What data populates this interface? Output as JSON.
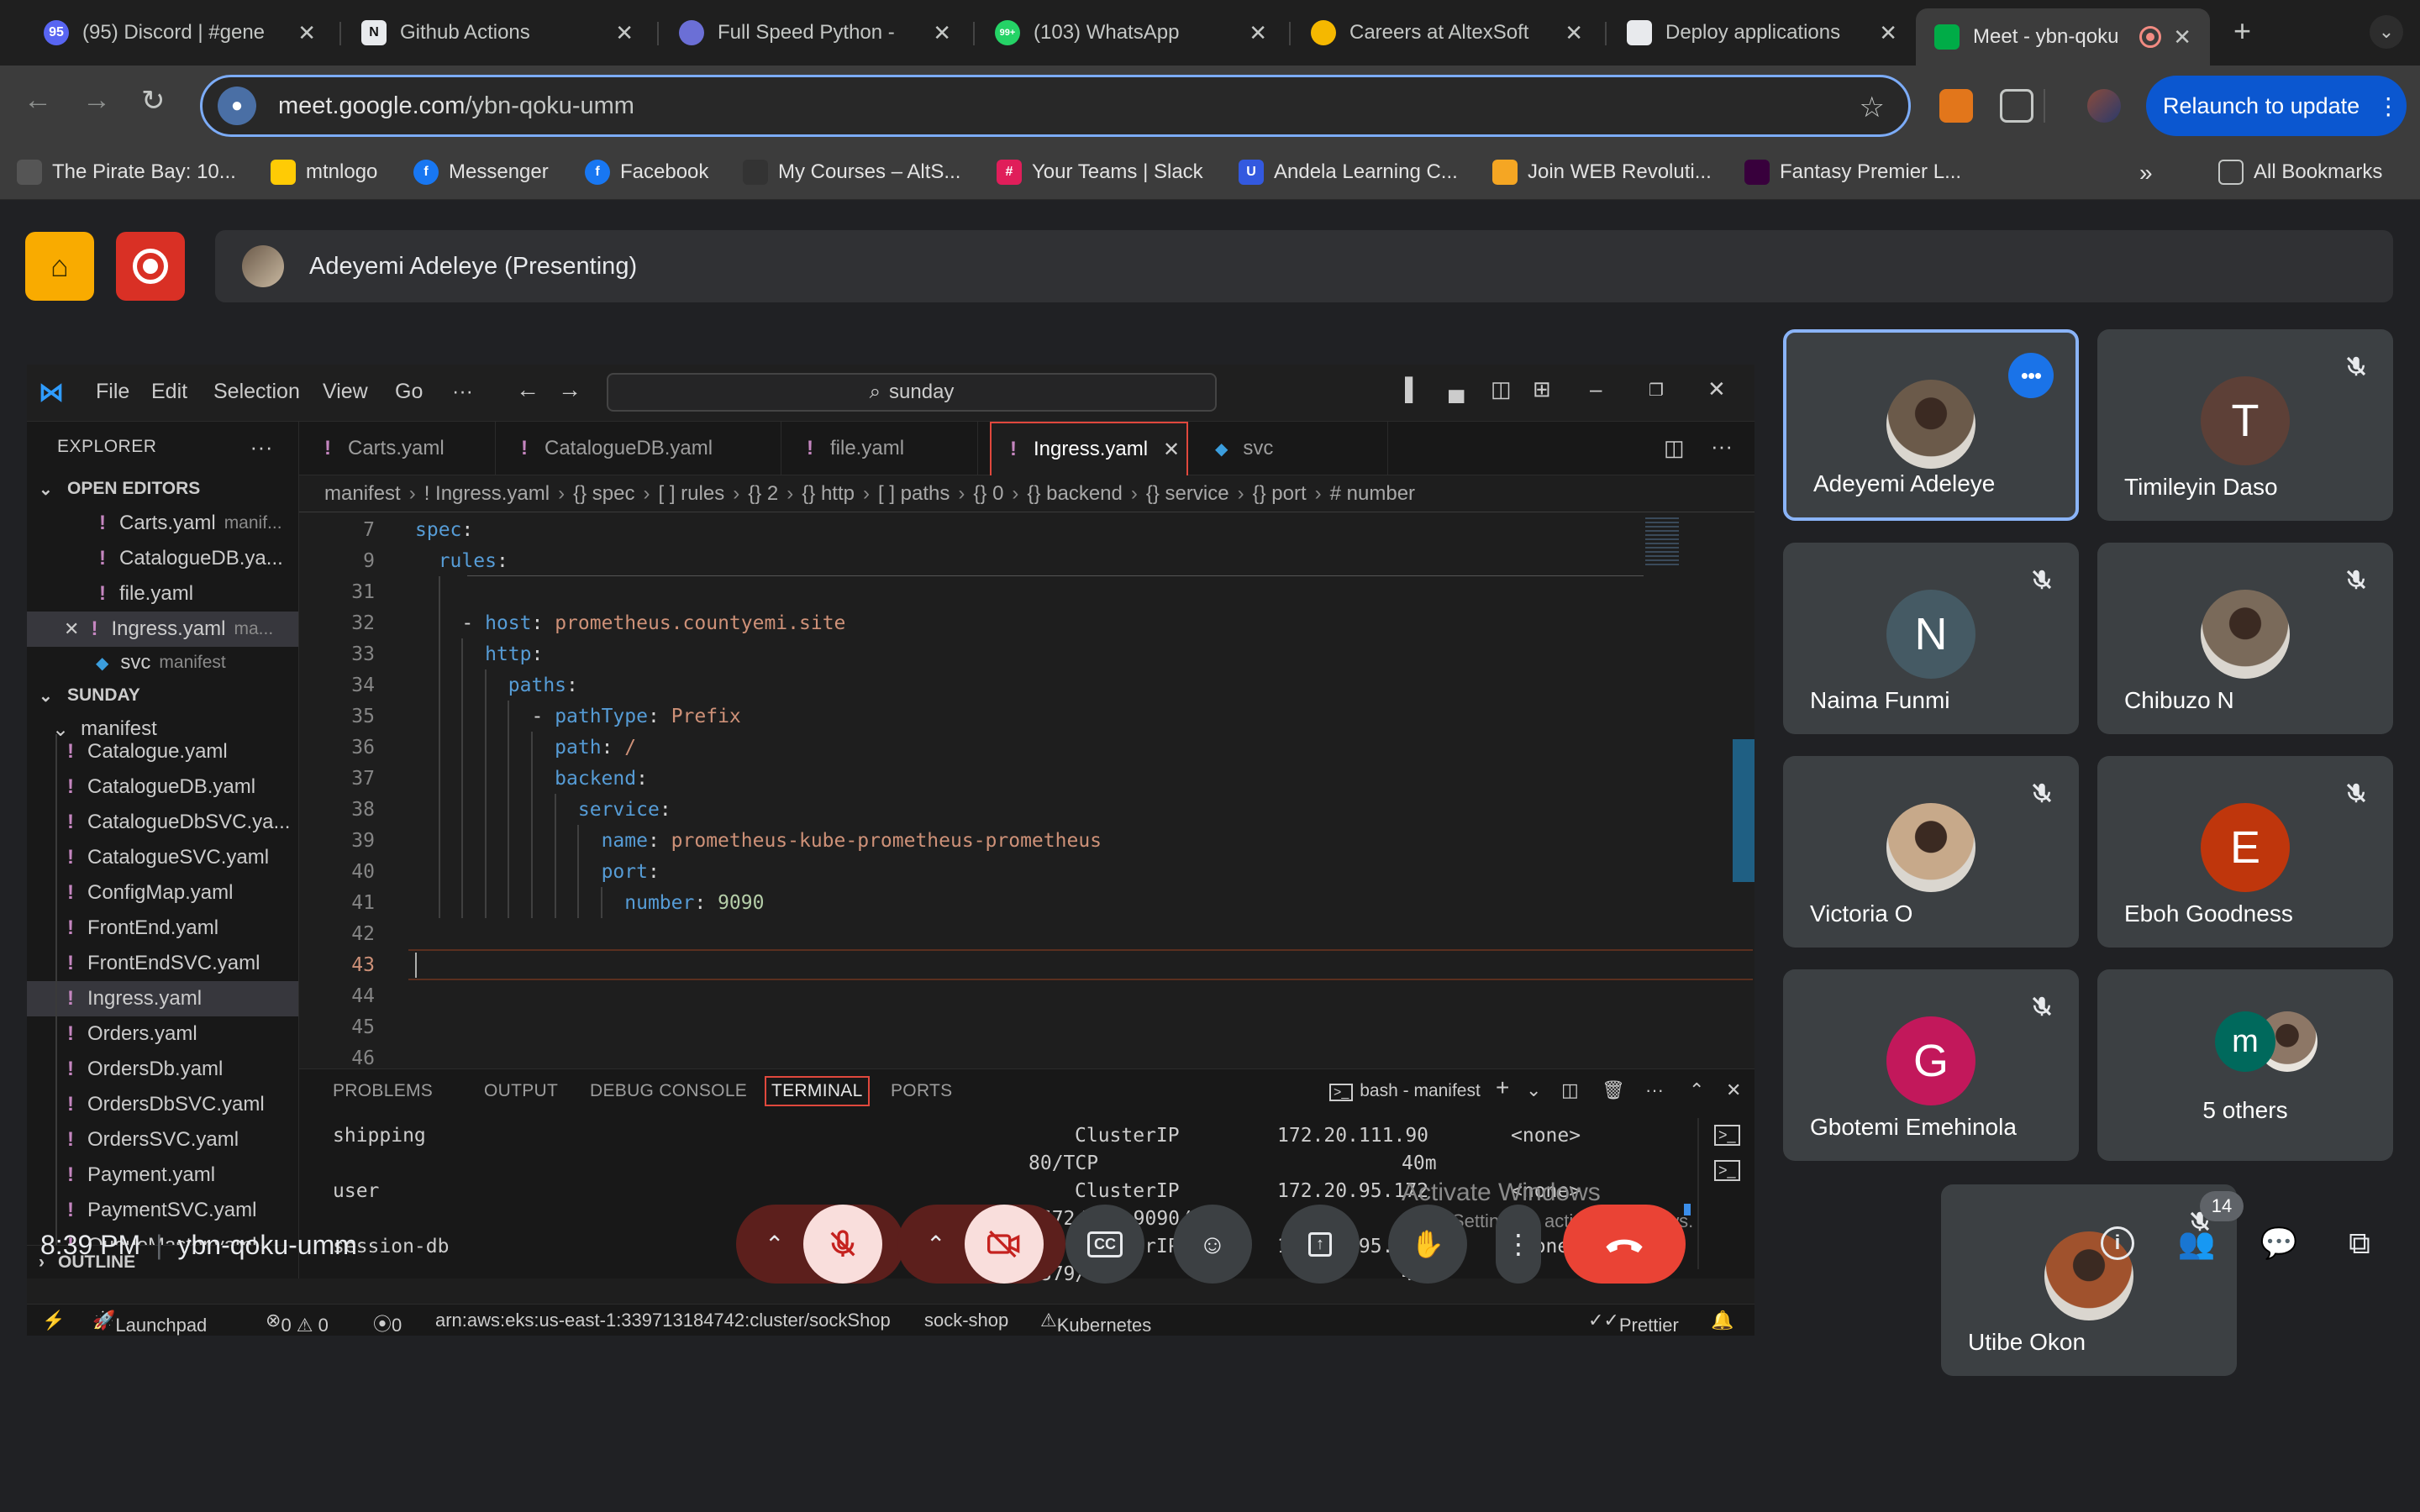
{
  "browser": {
    "tabs": [
      {
        "title": "(95) Discord | #gene",
        "color": "#5865f2",
        "badge": "95"
      },
      {
        "title": "Github Actions",
        "color": "#ffffff",
        "badge": "N"
      },
      {
        "title": "Full Speed Python -",
        "color": "#6b6fd6",
        "badge": ""
      },
      {
        "title": "(103) WhatsApp",
        "color": "#25d366",
        "badge": "99+"
      },
      {
        "title": "Careers at AltexSoft",
        "color": "#f5b800",
        "badge": ""
      },
      {
        "title": "Deploy applications",
        "color": "#e8eaed",
        "badge": ""
      },
      {
        "title": "Meet - ybn-qoku",
        "color": "#00ac47",
        "badge": ""
      }
    ],
    "url_host": "meet.google.com",
    "url_path": "/ybn-qoku-umm",
    "relaunch_label": "Relaunch to update",
    "bookmarks": [
      {
        "label": "The Pirate Bay: 10...",
        "color": "#555"
      },
      {
        "label": "mtnlogo",
        "color": "#ffcb05"
      },
      {
        "label": "Messenger",
        "color": "#1877f2"
      },
      {
        "label": "Facebook",
        "color": "#1877f2"
      },
      {
        "label": "My Courses – AltS...",
        "color": "#333"
      },
      {
        "label": "Your Teams | Slack",
        "color": "#e01e5a"
      },
      {
        "label": "Andela Learning C...",
        "color": "#3359df"
      },
      {
        "label": "Join WEB Revoluti...",
        "color": "#f5a623"
      },
      {
        "label": "Fantasy Premier L...",
        "color": "#38003c"
      }
    ],
    "all_bookmarks": "All Bookmarks"
  },
  "meet": {
    "presenting_label": "Adeyemi Adeleye (Presenting)",
    "time": "8:39 PM",
    "meeting_code": "ybn-qoku-umm",
    "participant_count": "14",
    "participants": [
      {
        "name": "Adeyemi Adeleye",
        "initial": "",
        "color": "#6b5a4a",
        "photo": true
      },
      {
        "name": "Timileyin Daso",
        "initial": "T",
        "color": "#5d4037",
        "photo": false
      },
      {
        "name": "Naima Funmi",
        "initial": "N",
        "color": "#455a64",
        "photo": false
      },
      {
        "name": "Chibuzo N",
        "initial": "",
        "color": "#7a6a5a",
        "photo": true
      },
      {
        "name": "Victoria O",
        "initial": "",
        "color": "#c7a98a",
        "photo": true
      },
      {
        "name": "Eboh Goodness",
        "initial": "E",
        "color": "#bf360c",
        "photo": false
      },
      {
        "name": "Gbotemi Emehinola",
        "initial": "G",
        "color": "#c2185b",
        "photo": false
      },
      {
        "name": "5 others",
        "initial": "m",
        "color": "#00695c",
        "photo": false
      },
      {
        "name": "Utibe Okon",
        "initial": "",
        "color": "#a0522d",
        "photo": true
      }
    ]
  },
  "vscode": {
    "menu": [
      "File",
      "Edit",
      "Selection",
      "View",
      "Go",
      "···"
    ],
    "search": "sunday",
    "explorer_title": "EXPLORER",
    "open_editors_title": "OPEN EDITORS",
    "open_editors": [
      {
        "name": "Carts.yaml",
        "hint": "manif...",
        "svc": false,
        "close": false
      },
      {
        "name": "CatalogueDB.ya...",
        "hint": "",
        "svc": false,
        "close": false
      },
      {
        "name": "file.yaml",
        "hint": "",
        "svc": false,
        "close": false
      },
      {
        "name": "Ingress.yaml",
        "hint": "ma...",
        "svc": false,
        "close": true
      },
      {
        "name": "svc",
        "hint": "manifest",
        "svc": true,
        "close": false
      }
    ],
    "workspace_title": "SUNDAY",
    "folder": "manifest",
    "files": [
      "Catalogue.yaml",
      "CatalogueDB.yaml",
      "CatalogueDbSVC.ya...",
      "CatalogueSVC.yaml",
      "ConfigMap.yaml",
      "FrontEnd.yaml",
      "FrontEndSVC.yaml",
      "Ingress.yaml",
      "Orders.yaml",
      "OrdersDb.yaml",
      "OrdersDbSVC.yaml",
      "OrdersSVC.yaml",
      "Payment.yaml",
      "PaymentSVC.yaml",
      "QueueMaster.yaml"
    ],
    "outline_title": "OUTLINE",
    "editor_tabs": [
      "Carts.yaml",
      "CatalogueDB.yaml",
      "file.yaml",
      "Ingress.yaml",
      "svc"
    ],
    "breadcrumbs": [
      "manifest",
      "! Ingress.yaml",
      "{} spec",
      "[ ] rules",
      "{} 2",
      "{} http",
      "[ ] paths",
      "{} 0",
      "{} backend",
      "{} service",
      "{} port",
      "# number"
    ],
    "code_lines": [
      {
        "num": "7",
        "indent": 0,
        "key": "spec",
        "val": "",
        "type": "",
        "dash": false
      },
      {
        "num": "9",
        "indent": 1,
        "key": "rules",
        "val": "",
        "type": "",
        "dash": false
      },
      {
        "num": "31",
        "indent": 2,
        "key": "",
        "val": "",
        "type": "",
        "dash": false
      },
      {
        "num": "32",
        "indent": 2,
        "key": "host",
        "val": "prometheus.countyemi.site",
        "type": "s",
        "dash": true
      },
      {
        "num": "33",
        "indent": 3,
        "key": "http",
        "val": "",
        "type": "",
        "dash": false
      },
      {
        "num": "34",
        "indent": 4,
        "key": "paths",
        "val": "",
        "type": "",
        "dash": false
      },
      {
        "num": "35",
        "indent": 5,
        "key": "pathType",
        "val": "Prefix",
        "type": "s",
        "dash": true
      },
      {
        "num": "36",
        "indent": 6,
        "key": "path",
        "val": "/",
        "type": "s",
        "dash": false
      },
      {
        "num": "37",
        "indent": 6,
        "key": "backend",
        "val": "",
        "type": "",
        "dash": false
      },
      {
        "num": "38",
        "indent": 7,
        "key": "service",
        "val": "",
        "type": "",
        "dash": false
      },
      {
        "num": "39",
        "indent": 8,
        "key": "name",
        "val": "prometheus-kube-prometheus-prometheus",
        "type": "s",
        "dash": false
      },
      {
        "num": "40",
        "indent": 8,
        "key": "port",
        "val": "",
        "type": "",
        "dash": false
      },
      {
        "num": "41",
        "indent": 9,
        "key": "number",
        "val": "9090",
        "type": "n",
        "dash": false
      },
      {
        "num": "42",
        "indent": 0,
        "key": "",
        "val": "",
        "type": "",
        "dash": false
      },
      {
        "num": "43",
        "indent": 0,
        "key": "",
        "val": "",
        "type": "",
        "dash": false
      },
      {
        "num": "44",
        "indent": 0,
        "key": "",
        "val": "",
        "type": "",
        "dash": false
      },
      {
        "num": "45",
        "indent": 0,
        "key": "",
        "val": "",
        "type": "",
        "dash": false
      },
      {
        "num": "46",
        "indent": 0,
        "key": "",
        "val": "",
        "type": "",
        "dash": false
      }
    ],
    "current_line": "43",
    "panel_tabs": [
      "PROBLEMS",
      "OUTPUT",
      "DEBUG CONSOLE",
      "TERMINAL",
      "PORTS"
    ],
    "active_panel_tab": "TERMINAL",
    "terminal_name": "bash - manifest",
    "terminal_rows": [
      {
        "name": "shipping",
        "type": "ClusterIP",
        "ip": "172.20.111.90",
        "ext": "<none>"
      },
      {
        "name": "",
        "type": "80/TCP",
        "ip": "40m",
        "ext": ""
      },
      {
        "name": "user",
        "type": "ClusterIP",
        "ip": "172.20.95.172",
        "ext": "<none>"
      },
      {
        "name": "",
        "type": "5672/TCP,9090/TCP",
        "ip": "40m",
        "ext": ""
      },
      {
        "name": "session-db",
        "type": "ClusterIP",
        "ip": "172.20.95.158",
        "ext": "<none>"
      },
      {
        "name": "",
        "type": "6379/TCP",
        "ip": "40m",
        "ext": ""
      }
    ],
    "activate_title": "Activate Windows",
    "activate_sub": "Go to Settings to activate Windows.",
    "status": {
      "launchpad": "Launchpad",
      "problems": "0 ⚠ 0",
      "ports": "0",
      "cluster": "arn:aws:eks:us-east-1:339713184742:cluster/sockShop",
      "namespace": "sock-shop",
      "kubernetes": "Kubernetes",
      "prettier": "Prettier"
    }
  }
}
